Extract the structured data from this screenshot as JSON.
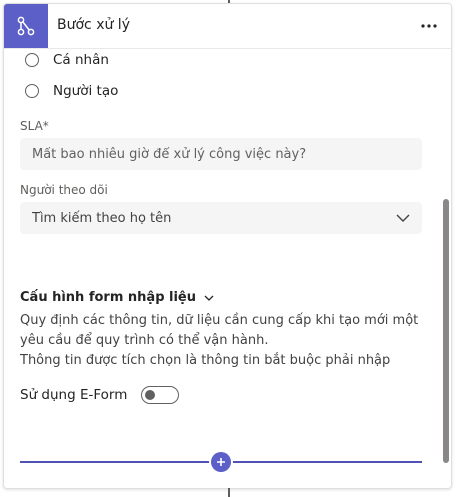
{
  "header": {
    "title": "Bước xử lý",
    "step_icon": "flow-branch-icon",
    "more_icon": "more-horizontal-icon"
  },
  "assignee_options": [
    {
      "label": "Cá nhân"
    },
    {
      "label": "Người tạo"
    }
  ],
  "sla": {
    "label": "SLA*",
    "placeholder": "Mất bao nhiêu giờ để xử lý công việc này?"
  },
  "follower": {
    "label": "Người theo dõi",
    "placeholder": "Tìm kiếm theo họ tên",
    "icon": "chevron-down-icon"
  },
  "form_config": {
    "title": "Cấu hình form nhập liệu",
    "icon": "chevron-down-icon",
    "description_line1": "Quy định các thông tin, dữ liệu cần cung cấp khi tạo mới một yêu cầu để quy trình có thể vận hành.",
    "description_line2": "Thông tin được tích chọn là thông tin bắt buộc phải nhập",
    "eform_label": "Sử dụng E-Form",
    "eform_enabled": false
  },
  "add_step": {
    "icon": "plus-icon"
  },
  "colors": {
    "accent": "#5b5fc7",
    "line": "#4f52b2",
    "input_bg": "#f5f5f5"
  }
}
